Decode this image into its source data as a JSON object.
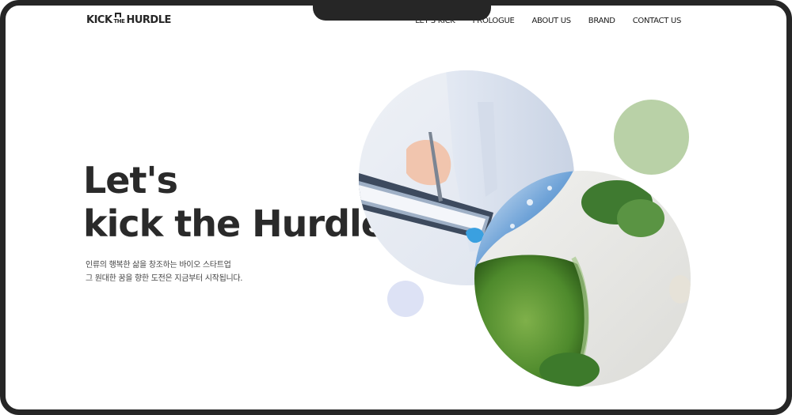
{
  "header": {
    "logo": {
      "kick": "KICK",
      "the": "THE",
      "hurdle": "HURDLE"
    },
    "nav": [
      "LET'S KICK",
      "PROLOGUE",
      "ABOUT US",
      "BRAND",
      "CONTACT US"
    ]
  },
  "hero": {
    "title_line1": "Let's",
    "title_line2": "kick the Hurdle.",
    "subtitle_line1": "인류의 행복한 삶을 창조하는 바이오 스타트업",
    "subtitle_line2": "그 원대한 꿈을 향한 도전은 지금부터 시작됩니다."
  },
  "colors": {
    "frame": "#262626",
    "text": "#2a2a2a",
    "green_dot": "#b9d1a7",
    "blue_dot": "#dde2f5"
  }
}
